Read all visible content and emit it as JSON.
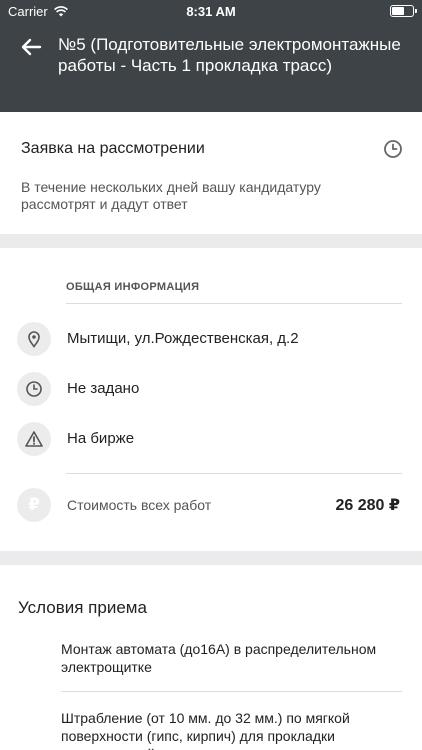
{
  "status_bar": {
    "carrier": "Carrier",
    "time": "8:31 AM"
  },
  "header": {
    "title": "№5 (Подготовительные электромонтажные работы - Часть 1 прокладка трасс)",
    "background": "#3d4346"
  },
  "application_status": {
    "title": "Заявка на рассмотрении",
    "description": "В течение нескольких дней вашу кандидатуру рассмотрят и дадут ответ",
    "icon": "clock-icon"
  },
  "general_info": {
    "header": "ОБЩАЯ ИНФОРМАЦИЯ",
    "items": [
      {
        "icon": "location-pin-icon",
        "text": "Мытищи, ул.Рождественская, д.2"
      },
      {
        "icon": "clock-icon",
        "text": "Не задано"
      },
      {
        "icon": "warning-icon",
        "text": "На бирже"
      }
    ],
    "cost": {
      "icon": "ruble-icon",
      "label": "Стоимость всех работ",
      "value": "26 280 ₽"
    }
  },
  "conditions": {
    "title": "Условия приема",
    "items": [
      "Монтаж автомата (до16А) в распределительном электрощитке",
      "Штрабление (от 10 мм. до 32 мм.) по мягкой поверхности (гипс, кирпич) для прокладки коммуникаций"
    ]
  }
}
